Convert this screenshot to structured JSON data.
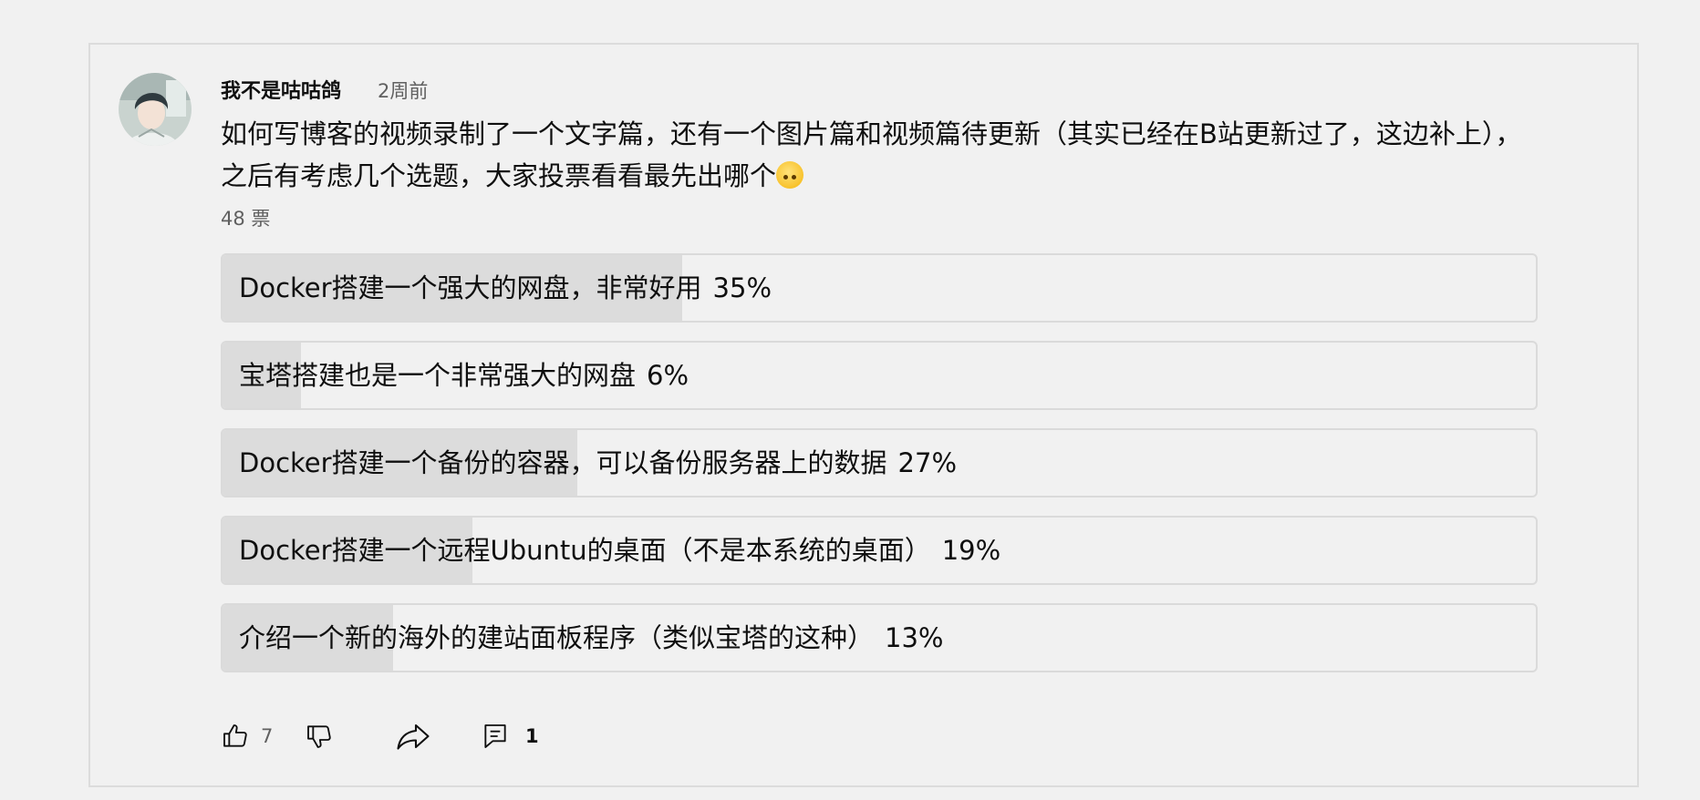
{
  "post": {
    "author": "我不是咕咕鸽",
    "time": "2周前",
    "text": "如何写博客的视频录制了一个文字篇，还有一个图片篇和视频篇待更新（其实已经在B站更新过了，这边补上），之后有考虑几个选题，大家投票看看最先出哪个",
    "emoji": "upside-down-face",
    "votes": "48 票"
  },
  "poll": {
    "options": [
      {
        "label": "Docker搭建一个强大的网盘，非常好用",
        "percent_text": "35%",
        "percent": 35
      },
      {
        "label": "宝塔搭建也是一个非常强大的网盘",
        "percent_text": "6%",
        "percent": 6
      },
      {
        "label": "Docker搭建一个备份的容器，可以备份服务器上的数据",
        "percent_text": "27%",
        "percent": 27
      },
      {
        "label": "Docker搭建一个远程Ubuntu的桌面（不是本系统的桌面）",
        "percent_text": "19%",
        "percent": 19
      },
      {
        "label": "介绍一个新的海外的建站面板程序（类似宝塔的这种）",
        "percent_text": "13%",
        "percent": 13
      }
    ]
  },
  "actions": {
    "like_count": "7",
    "reply_count": "1",
    "icons": [
      "thumbs-up-icon",
      "thumbs-down-icon",
      "share-icon",
      "comment-icon"
    ]
  },
  "colors": {
    "background": "#f1f1f1",
    "poll_fill": "#dcdcdc",
    "border": "#dadada",
    "secondary_text": "#606060"
  }
}
